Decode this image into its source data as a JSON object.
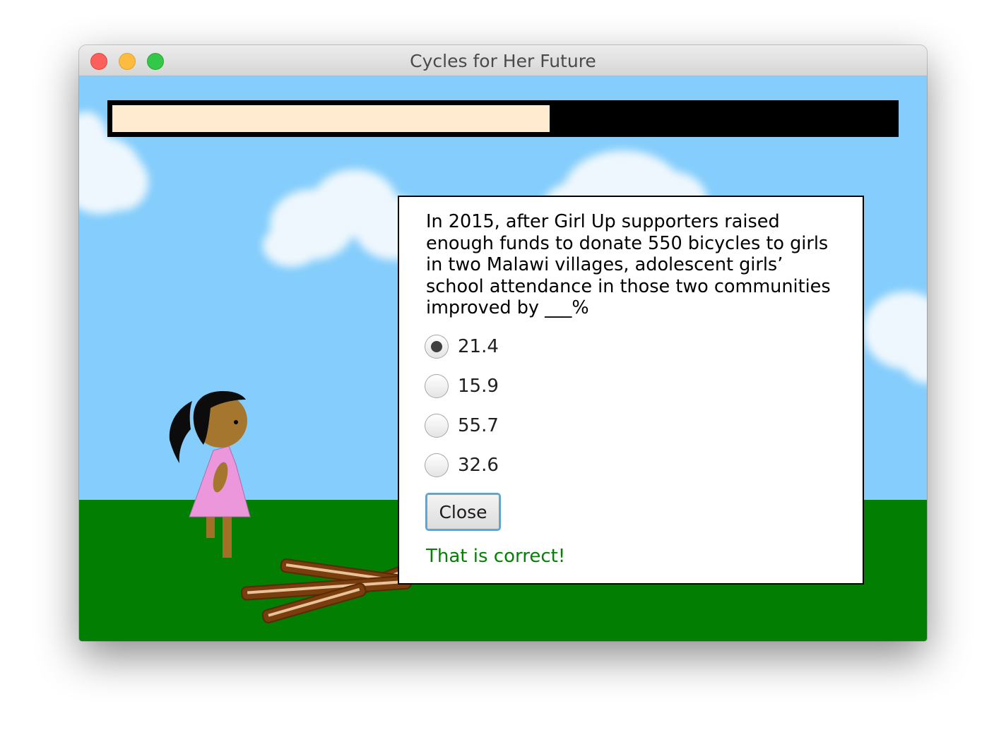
{
  "window": {
    "title": "Cycles for Her Future"
  },
  "progress": {
    "fraction": 0.56
  },
  "colors": {
    "sky": "#84cdfc",
    "grass": "#027e02",
    "progress_track": "#000000",
    "progress_fill": "#feebd0",
    "dress": "#ec96dc",
    "skin": "#a5762e",
    "hair": "#0c0c0c",
    "feedback": "#048004"
  },
  "quiz": {
    "question": "In 2015, after Girl Up supporters raised enough funds to donate 550 bicycles to girls in two Malawi villages, adolescent girls’ school attendance in those two communities improved by ___%",
    "options": [
      {
        "label": "21.4",
        "selected": true
      },
      {
        "label": "15.9",
        "selected": false
      },
      {
        "label": "55.7",
        "selected": false
      },
      {
        "label": "32.6",
        "selected": false
      }
    ],
    "close_label": "Close",
    "feedback": "That is correct!"
  }
}
